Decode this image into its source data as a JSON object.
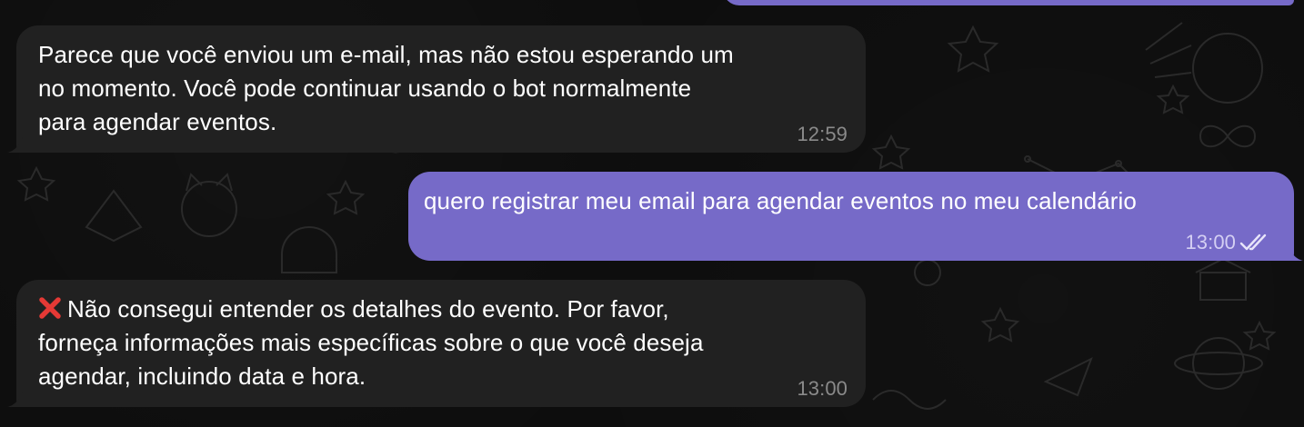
{
  "messages": [
    {
      "direction": "incoming",
      "text": "Parece que você enviou um e-mail, mas não estou esperando um\nno momento. Você pode continuar usando o bot normalmente\npara agendar eventos.",
      "time": "12:59"
    },
    {
      "direction": "outgoing",
      "text": "quero registrar meu email para agendar eventos no meu calendário",
      "time": "13:00",
      "status": "read-double-check-icon"
    },
    {
      "direction": "incoming",
      "icon": "cross-mark-icon",
      "text": "Não consegui entender os detalhes do evento. Por favor,\nforneça informações mais específicas sobre o que você deseja\nagendar, incluindo data e hora.",
      "time": "13:00"
    }
  ],
  "colors": {
    "background": "#0d0d0d",
    "incoming_bubble": "#212121",
    "outgoing_bubble": "#766ac8",
    "error_icon": "#e53935"
  }
}
